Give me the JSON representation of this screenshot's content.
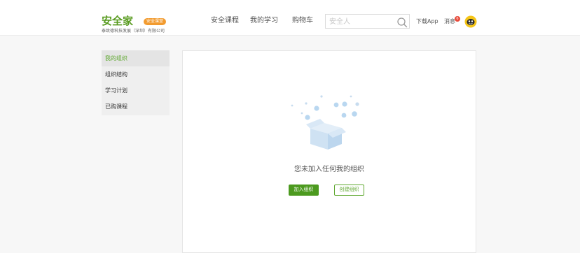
{
  "header": {
    "logo_title": "安全家",
    "logo_badge": "安全课堂",
    "logo_subtitle": "泰致德科技发展（深圳）有限公司",
    "nav": [
      "安全课程",
      "我的学习",
      "购物车"
    ],
    "search_placeholder": "安全人",
    "download_label": "下载App",
    "messages_label": "消息",
    "messages_count": "6"
  },
  "sidebar": {
    "items": [
      {
        "label": "我的组织",
        "active": true
      },
      {
        "label": "组织结构",
        "active": false
      },
      {
        "label": "学习计划",
        "active": false
      },
      {
        "label": "已购课程",
        "active": false
      }
    ]
  },
  "main": {
    "empty_message": "您未加入任何我的组织",
    "join_button": "加入组织",
    "create_button": "创建组织"
  },
  "colors": {
    "brand_green": "#5a9c22",
    "primary_button": "#4c9a1f",
    "badge_orange": "#f29b2f",
    "notification_red": "#e84a3a",
    "illustration_blue": "#b9d7f0"
  }
}
